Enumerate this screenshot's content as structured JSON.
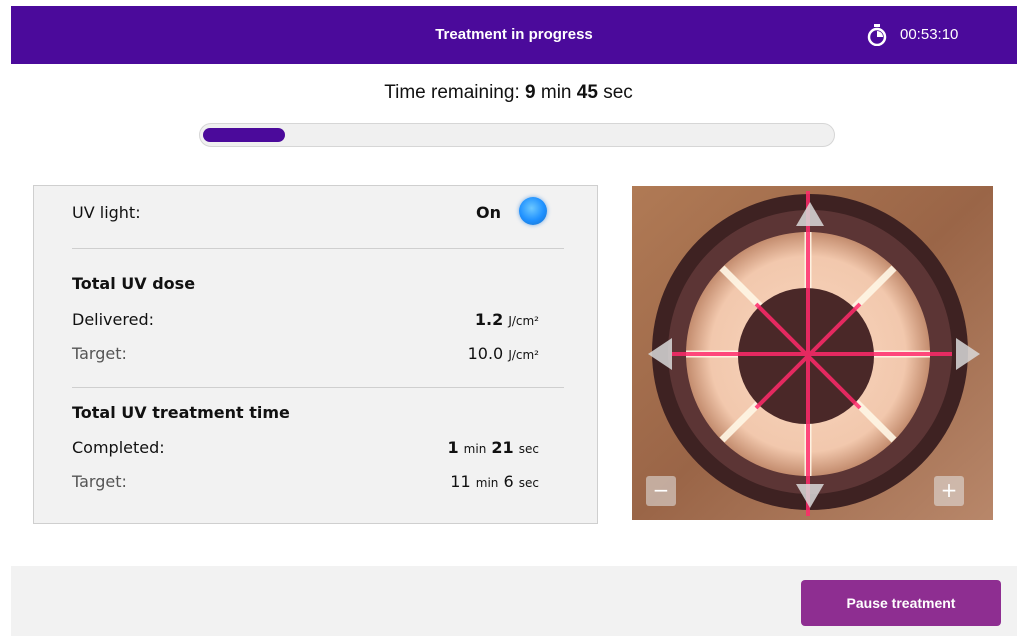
{
  "header": {
    "title": "Treatment in progress",
    "timer_icon": "stopwatch-icon",
    "elapsed": "00:53:10"
  },
  "remaining": {
    "prefix": "Time remaining: ",
    "minutes": "9",
    "min_unit": " min ",
    "seconds": "45",
    "sec_unit": " sec",
    "progress_fraction": 0.13
  },
  "uv_light": {
    "label": "UV light:",
    "status": "On",
    "indicator_color": "#1e90ff"
  },
  "dose": {
    "heading": "Total UV dose",
    "delivered_label": "Delivered:",
    "delivered_value": "1.2",
    "delivered_unit": "J/cm²",
    "target_label": "Target:",
    "target_value": "10.0",
    "target_unit": "J/cm²"
  },
  "treatment_time": {
    "heading": "Total UV treatment time",
    "completed_label": "Completed:",
    "completed_min": "1",
    "completed_min_unit": "min",
    "completed_sec": "21",
    "completed_sec_unit": "sec",
    "target_label": "Target:",
    "target_min": "11",
    "target_min_unit": "min",
    "target_sec": "6",
    "target_sec_unit": "sec"
  },
  "camera": {
    "zoom_out_label": "−",
    "zoom_in_label": "+",
    "arrow_icons": [
      "arrow-up-icon",
      "arrow-down-icon",
      "arrow-left-icon",
      "arrow-right-icon"
    ]
  },
  "footer": {
    "pause_label": "Pause treatment"
  },
  "colors": {
    "brand": "#4b0a9b",
    "button": "#8e2e91"
  }
}
